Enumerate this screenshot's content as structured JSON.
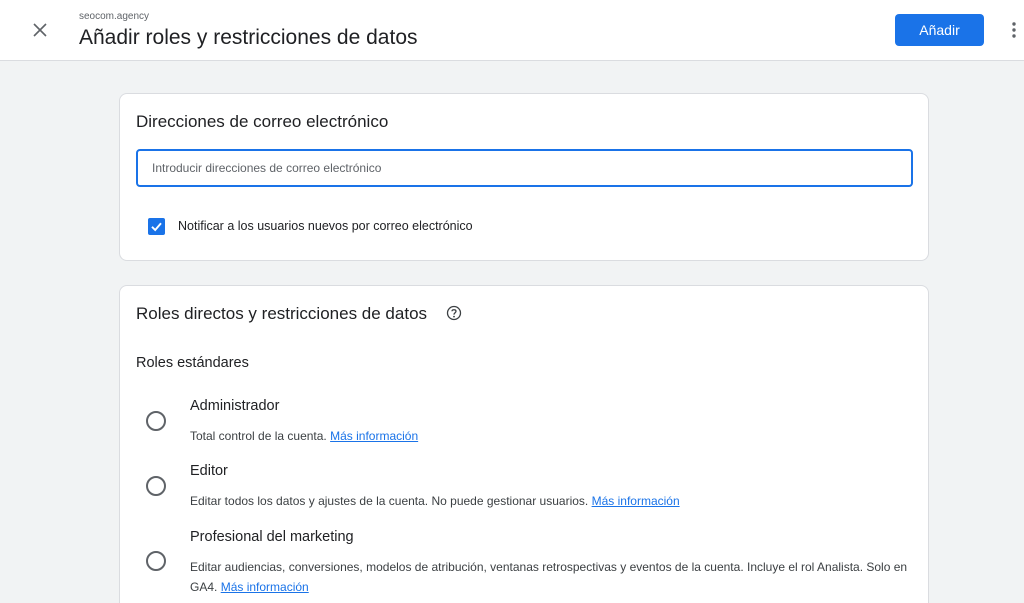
{
  "header": {
    "subtitle": "seocom.agency",
    "title": "Añadir roles y restricciones de datos",
    "add_label": "Añadir",
    "close_icon": "close-icon",
    "more_icon": "more-vert-icon"
  },
  "email_card": {
    "title": "Direcciones de correo electrónico",
    "input_placeholder": "Introducir direcciones de correo electrónico",
    "input_value": "",
    "notify_label": "Notificar a los usuarios nuevos por correo electrónico",
    "notify_checked": true
  },
  "roles_card": {
    "title": "Roles directos y restricciones de datos",
    "help_icon": "help-icon",
    "section_label": "Roles estándares",
    "link_label": "Más información",
    "roles": [
      {
        "name": "Administrador",
        "description": "Total control de la cuenta.",
        "selected": false
      },
      {
        "name": "Editor",
        "description": "Editar todos los datos y ajustes de la cuenta. No puede gestionar usuarios.",
        "selected": false
      },
      {
        "name": "Profesional del marketing",
        "description": "Editar audiencias, conversiones, modelos de atribución, ventanas retrospectivas y eventos de la cuenta. Incluye el rol Analista. Solo en GA4.",
        "selected": false
      }
    ]
  },
  "colors": {
    "accent": "#1a73e8",
    "background": "#f1f3f4",
    "text": "#202124"
  }
}
